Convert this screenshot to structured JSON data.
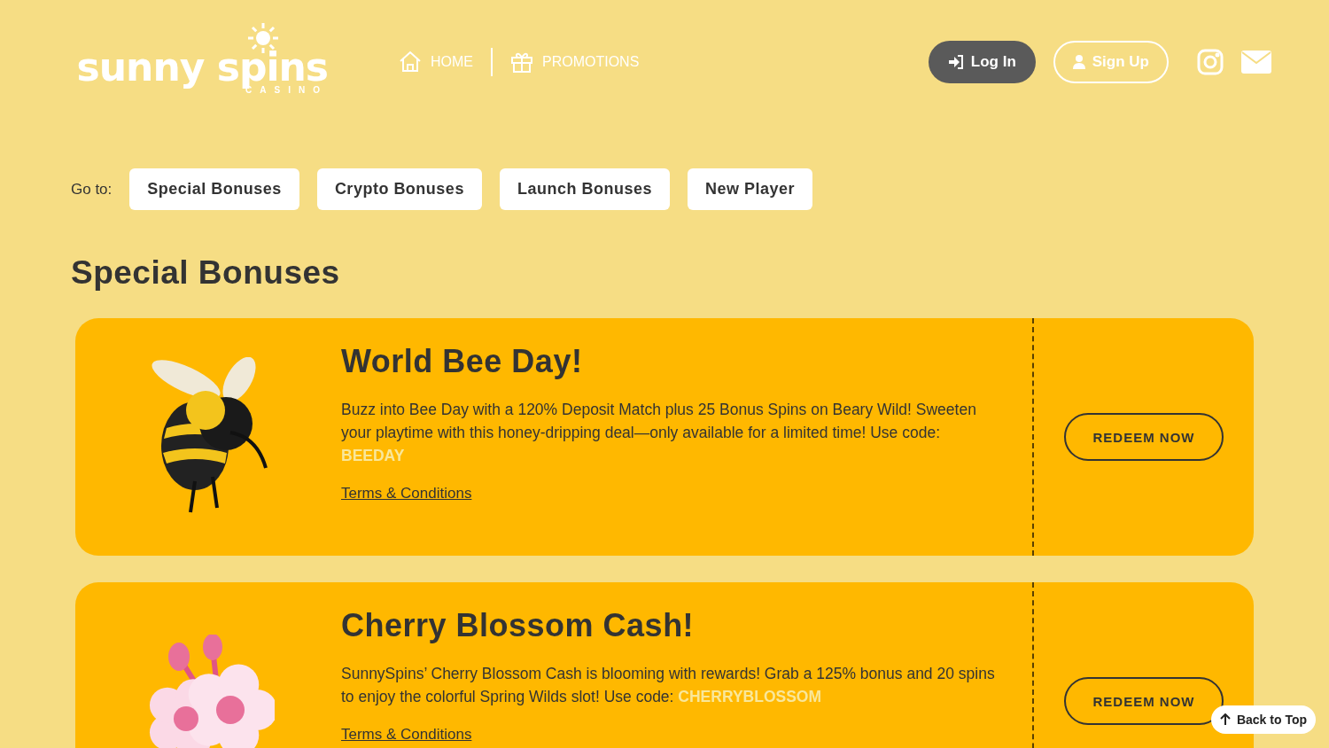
{
  "logo": {
    "name": "sunny spins",
    "subtitle": "CASINO"
  },
  "nav": [
    {
      "label": "HOME",
      "kind": "home"
    },
    {
      "label": "PROMOTIONS",
      "kind": "gift"
    }
  ],
  "auth": {
    "login": "Log In",
    "signup": "Sign Up"
  },
  "goto": {
    "label": "Go to:",
    "links": [
      "Special Bonuses",
      "Crypto Bonuses",
      "Launch Bonuses",
      "New Player"
    ]
  },
  "section_title": "Special Bonuses",
  "promos": [
    {
      "kind": "bee",
      "title": "World Bee Day!",
      "description": "Buzz into Bee Day with a 120% Deposit Match plus 25 Bonus Spins on Beary Wild! Sweeten your playtime with this honey-dripping deal—only available for a limited time! Use code: ",
      "code": "BEEDAY",
      "terms": "Terms & Conditions",
      "button": "REDEEM NOW"
    },
    {
      "kind": "flower",
      "title": "Cherry Blossom Cash!",
      "description": "SunnySpins’ Cherry Blossom Cash is blooming with rewards! Grab a 125% bonus and 20 spins to enjoy the colorful Spring Wilds slot! Use code: ",
      "code": "CHERRYBLOSSOM",
      "terms": "Terms & Conditions",
      "button": "REDEEM NOW"
    }
  ],
  "back_to_top": "Back to Top"
}
